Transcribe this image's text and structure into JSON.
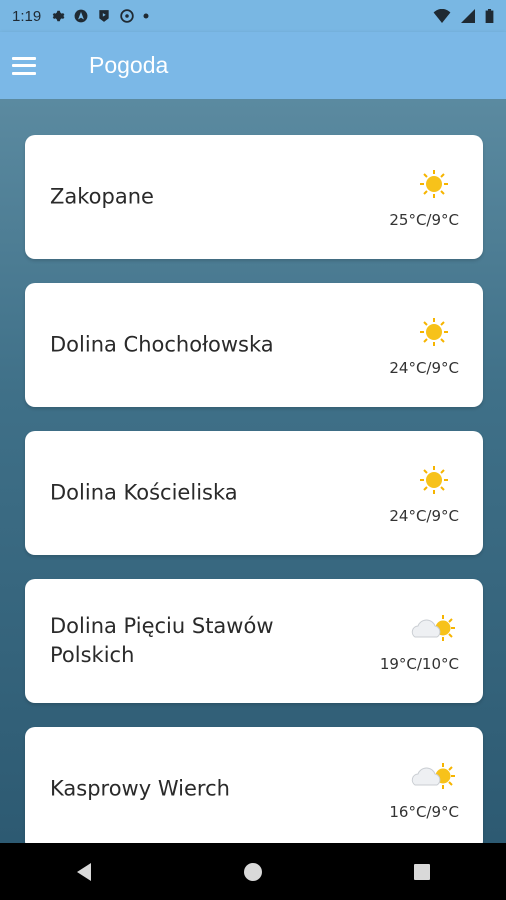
{
  "status": {
    "time": "1:19",
    "icons": [
      "settings-icon",
      "navigation-icon",
      "play-icon",
      "vpn-icon",
      "dot-icon"
    ],
    "right_icons": [
      "wifi-icon",
      "signal-icon",
      "battery-icon"
    ]
  },
  "appbar": {
    "title": "Pogoda",
    "menu_icon": "hamburger-menu-icon"
  },
  "locations": [
    {
      "name": "Zakopane",
      "icon": "sun-icon",
      "temps": "25°C/9°C"
    },
    {
      "name": "Dolina Chochołowska",
      "icon": "sun-icon",
      "temps": "24°C/9°C"
    },
    {
      "name": "Dolina Kościeliska",
      "icon": "sun-icon",
      "temps": "24°C/9°C"
    },
    {
      "name": "Dolina Pięciu Stawów Polskich",
      "icon": "partly-cloudy-icon",
      "temps": "19°C/10°C"
    },
    {
      "name": "Kasprowy Wierch",
      "icon": "partly-cloudy-icon",
      "temps": "16°C/9°C"
    }
  ],
  "navbar": {
    "buttons": [
      "back-icon",
      "home-icon",
      "recents-icon"
    ]
  },
  "colors": {
    "appbar": "#7bb8e7",
    "sun": "#f6b400",
    "card": "#ffffff"
  }
}
